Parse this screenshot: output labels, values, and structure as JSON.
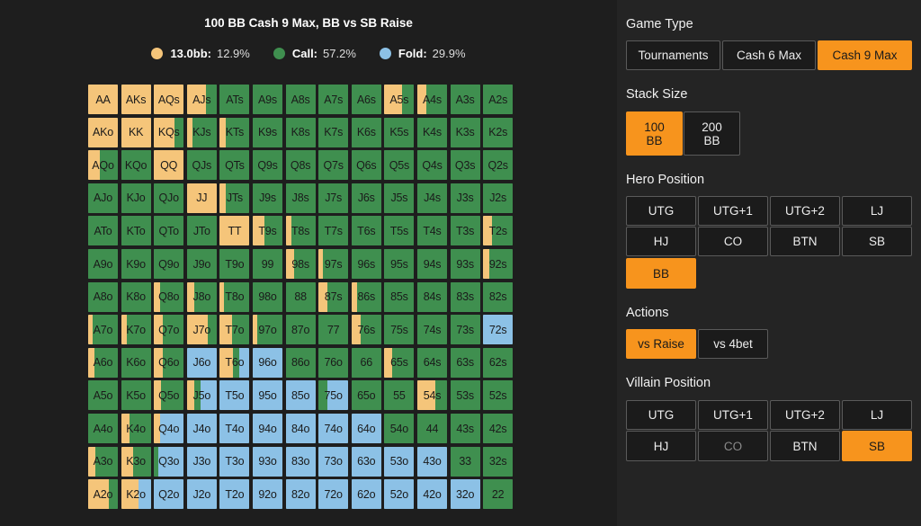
{
  "chart": {
    "title": "100 BB Cash 9 Max, BB vs SB Raise",
    "legend": [
      {
        "label": "13.0bb:",
        "value": "12.9%",
        "color": "#f5c57a"
      },
      {
        "label": "Call:",
        "value": "57.2%",
        "color": "#3f8f4f"
      },
      {
        "label": "Fold:",
        "value": "29.9%",
        "color": "#8cc1e6"
      }
    ]
  },
  "grid": [
    [
      {
        "h": "AA",
        "r": 1,
        "c": 0
      },
      {
        "h": "AKs",
        "r": 1,
        "c": 0
      },
      {
        "h": "AQs",
        "r": 1,
        "c": 0
      },
      {
        "h": "AJs",
        "r": 0.65,
        "c": 0.35
      },
      {
        "h": "ATs",
        "r": 0,
        "c": 1
      },
      {
        "h": "A9s",
        "r": 0,
        "c": 1
      },
      {
        "h": "A8s",
        "r": 0,
        "c": 1
      },
      {
        "h": "A7s",
        "r": 0,
        "c": 1
      },
      {
        "h": "A6s",
        "r": 0,
        "c": 1
      },
      {
        "h": "A5s",
        "r": 0.6,
        "c": 0.4
      },
      {
        "h": "A4s",
        "r": 0.3,
        "c": 0.7
      },
      {
        "h": "A3s",
        "r": 0,
        "c": 1
      },
      {
        "h": "A2s",
        "r": 0,
        "c": 1
      }
    ],
    [
      {
        "h": "AKo",
        "r": 1,
        "c": 0
      },
      {
        "h": "KK",
        "r": 1,
        "c": 0
      },
      {
        "h": "KQs",
        "r": 0.7,
        "c": 0.3
      },
      {
        "h": "KJs",
        "r": 0.2,
        "c": 0.8
      },
      {
        "h": "KTs",
        "r": 0.2,
        "c": 0.8
      },
      {
        "h": "K9s",
        "r": 0,
        "c": 1
      },
      {
        "h": "K8s",
        "r": 0,
        "c": 1
      },
      {
        "h": "K7s",
        "r": 0,
        "c": 1
      },
      {
        "h": "K6s",
        "r": 0,
        "c": 1
      },
      {
        "h": "K5s",
        "r": 0,
        "c": 1
      },
      {
        "h": "K4s",
        "r": 0,
        "c": 1
      },
      {
        "h": "K3s",
        "r": 0,
        "c": 1
      },
      {
        "h": "K2s",
        "r": 0,
        "c": 1
      }
    ],
    [
      {
        "h": "AQo",
        "r": 0.4,
        "c": 0.6
      },
      {
        "h": "KQo",
        "r": 0,
        "c": 1
      },
      {
        "h": "QQ",
        "r": 1,
        "c": 0
      },
      {
        "h": "QJs",
        "r": 0,
        "c": 1
      },
      {
        "h": "QTs",
        "r": 0,
        "c": 1
      },
      {
        "h": "Q9s",
        "r": 0,
        "c": 1
      },
      {
        "h": "Q8s",
        "r": 0,
        "c": 1
      },
      {
        "h": "Q7s",
        "r": 0,
        "c": 1
      },
      {
        "h": "Q6s",
        "r": 0,
        "c": 1
      },
      {
        "h": "Q5s",
        "r": 0,
        "c": 1
      },
      {
        "h": "Q4s",
        "r": 0,
        "c": 1
      },
      {
        "h": "Q3s",
        "r": 0,
        "c": 1
      },
      {
        "h": "Q2s",
        "r": 0,
        "c": 1
      }
    ],
    [
      {
        "h": "AJo",
        "r": 0,
        "c": 1
      },
      {
        "h": "KJo",
        "r": 0,
        "c": 1
      },
      {
        "h": "QJo",
        "r": 0,
        "c": 1
      },
      {
        "h": "JJ",
        "r": 1,
        "c": 0
      },
      {
        "h": "JTs",
        "r": 0.2,
        "c": 0.8
      },
      {
        "h": "J9s",
        "r": 0,
        "c": 1
      },
      {
        "h": "J8s",
        "r": 0,
        "c": 1
      },
      {
        "h": "J7s",
        "r": 0,
        "c": 1
      },
      {
        "h": "J6s",
        "r": 0,
        "c": 1
      },
      {
        "h": "J5s",
        "r": 0,
        "c": 1
      },
      {
        "h": "J4s",
        "r": 0,
        "c": 1
      },
      {
        "h": "J3s",
        "r": 0,
        "c": 1
      },
      {
        "h": "J2s",
        "r": 0,
        "c": 1
      }
    ],
    [
      {
        "h": "ATo",
        "r": 0,
        "c": 1
      },
      {
        "h": "KTo",
        "r": 0,
        "c": 1
      },
      {
        "h": "QTo",
        "r": 0,
        "c": 1
      },
      {
        "h": "JTo",
        "r": 0,
        "c": 1
      },
      {
        "h": "TT",
        "r": 1,
        "c": 0
      },
      {
        "h": "T9s",
        "r": 0.4,
        "c": 0.6
      },
      {
        "h": "T8s",
        "r": 0.2,
        "c": 0.8
      },
      {
        "h": "T7s",
        "r": 0,
        "c": 1
      },
      {
        "h": "T6s",
        "r": 0,
        "c": 1
      },
      {
        "h": "T5s",
        "r": 0,
        "c": 1
      },
      {
        "h": "T4s",
        "r": 0,
        "c": 1
      },
      {
        "h": "T3s",
        "r": 0,
        "c": 1
      },
      {
        "h": "T2s",
        "r": 0.3,
        "c": 0.7
      }
    ],
    [
      {
        "h": "A9o",
        "r": 0,
        "c": 1
      },
      {
        "h": "K9o",
        "r": 0,
        "c": 1
      },
      {
        "h": "Q9o",
        "r": 0,
        "c": 1
      },
      {
        "h": "J9o",
        "r": 0,
        "c": 1
      },
      {
        "h": "T9o",
        "r": 0,
        "c": 1
      },
      {
        "h": "99",
        "r": 0,
        "c": 1
      },
      {
        "h": "98s",
        "r": 0.3,
        "c": 0.7
      },
      {
        "h": "97s",
        "r": 0.15,
        "c": 0.85
      },
      {
        "h": "96s",
        "r": 0,
        "c": 1
      },
      {
        "h": "95s",
        "r": 0,
        "c": 1
      },
      {
        "h": "94s",
        "r": 0,
        "c": 1
      },
      {
        "h": "93s",
        "r": 0,
        "c": 1
      },
      {
        "h": "92s",
        "r": 0.2,
        "c": 0.8
      }
    ],
    [
      {
        "h": "A8o",
        "r": 0,
        "c": 1
      },
      {
        "h": "K8o",
        "r": 0,
        "c": 1
      },
      {
        "h": "Q8o",
        "r": 0.2,
        "c": 0.8
      },
      {
        "h": "J8o",
        "r": 0.25,
        "c": 0.75
      },
      {
        "h": "T8o",
        "r": 0.15,
        "c": 0.85
      },
      {
        "h": "98o",
        "r": 0,
        "c": 1
      },
      {
        "h": "88",
        "r": 0,
        "c": 1
      },
      {
        "h": "87s",
        "r": 0.3,
        "c": 0.7
      },
      {
        "h": "86s",
        "r": 0.2,
        "c": 0.8
      },
      {
        "h": "85s",
        "r": 0,
        "c": 1
      },
      {
        "h": "84s",
        "r": 0,
        "c": 1
      },
      {
        "h": "83s",
        "r": 0,
        "c": 1
      },
      {
        "h": "82s",
        "r": 0,
        "c": 1
      }
    ],
    [
      {
        "h": "A7o",
        "r": 0.15,
        "c": 0.85
      },
      {
        "h": "K7o",
        "r": 0.2,
        "c": 0.8
      },
      {
        "h": "Q7o",
        "r": 0.3,
        "c": 0.7
      },
      {
        "h": "J7o",
        "r": 0.7,
        "c": 0.3
      },
      {
        "h": "T7o",
        "r": 0.4,
        "c": 0.6
      },
      {
        "h": "97o",
        "r": 0.15,
        "c": 0.85
      },
      {
        "h": "87o",
        "r": 0,
        "c": 1
      },
      {
        "h": "77",
        "r": 0,
        "c": 1
      },
      {
        "h": "76s",
        "r": 0.3,
        "c": 0.7
      },
      {
        "h": "75s",
        "r": 0,
        "c": 1
      },
      {
        "h": "74s",
        "r": 0,
        "c": 1
      },
      {
        "h": "73s",
        "r": 0,
        "c": 1
      },
      {
        "h": "72s",
        "r": 0,
        "c": 0
      }
    ],
    [
      {
        "h": "A6o",
        "r": 0.2,
        "c": 0.8
      },
      {
        "h": "K6o",
        "r": 0,
        "c": 1
      },
      {
        "h": "Q6o",
        "r": 0.3,
        "c": 0.7
      },
      {
        "h": "J6o",
        "r": 0,
        "c": 0
      },
      {
        "h": "T6o",
        "r": 0.45,
        "c": 0.2
      },
      {
        "h": "96o",
        "r": 0,
        "c": 0
      },
      {
        "h": "86o",
        "r": 0,
        "c": 1
      },
      {
        "h": "76o",
        "r": 0,
        "c": 1
      },
      {
        "h": "66",
        "r": 0,
        "c": 1
      },
      {
        "h": "65s",
        "r": 0.25,
        "c": 0.75
      },
      {
        "h": "64s",
        "r": 0,
        "c": 1
      },
      {
        "h": "63s",
        "r": 0,
        "c": 1
      },
      {
        "h": "62s",
        "r": 0,
        "c": 1
      }
    ],
    [
      {
        "h": "A5o",
        "r": 0,
        "c": 1
      },
      {
        "h": "K5o",
        "r": 0,
        "c": 1
      },
      {
        "h": "Q5o",
        "r": 0.25,
        "c": 0.75
      },
      {
        "h": "J5o",
        "r": 0.25,
        "c": 0.2
      },
      {
        "h": "T5o",
        "r": 0,
        "c": 0
      },
      {
        "h": "95o",
        "r": 0,
        "c": 0
      },
      {
        "h": "85o",
        "r": 0,
        "c": 0
      },
      {
        "h": "75o",
        "r": 0,
        "c": 0.3
      },
      {
        "h": "65o",
        "r": 0,
        "c": 1
      },
      {
        "h": "55",
        "r": 0,
        "c": 1
      },
      {
        "h": "54s",
        "r": 0.6,
        "c": 0.4
      },
      {
        "h": "53s",
        "r": 0,
        "c": 1
      },
      {
        "h": "52s",
        "r": 0,
        "c": 1
      }
    ],
    [
      {
        "h": "A4o",
        "r": 0,
        "c": 1
      },
      {
        "h": "K4o",
        "r": 0.3,
        "c": 0.7
      },
      {
        "h": "Q4o",
        "r": 0.2,
        "c": 0
      },
      {
        "h": "J4o",
        "r": 0,
        "c": 0
      },
      {
        "h": "T4o",
        "r": 0,
        "c": 0
      },
      {
        "h": "94o",
        "r": 0,
        "c": 0
      },
      {
        "h": "84o",
        "r": 0,
        "c": 0
      },
      {
        "h": "74o",
        "r": 0,
        "c": 0
      },
      {
        "h": "64o",
        "r": 0,
        "c": 0
      },
      {
        "h": "54o",
        "r": 0,
        "c": 1
      },
      {
        "h": "44",
        "r": 0,
        "c": 1
      },
      {
        "h": "43s",
        "r": 0,
        "c": 1
      },
      {
        "h": "42s",
        "r": 0,
        "c": 1
      }
    ],
    [
      {
        "h": "A3o",
        "r": 0.25,
        "c": 0.75
      },
      {
        "h": "K3o",
        "r": 0.4,
        "c": 0.6
      },
      {
        "h": "Q3o",
        "r": 0,
        "c": 0.15
      },
      {
        "h": "J3o",
        "r": 0,
        "c": 0
      },
      {
        "h": "T3o",
        "r": 0,
        "c": 0
      },
      {
        "h": "93o",
        "r": 0,
        "c": 0
      },
      {
        "h": "83o",
        "r": 0,
        "c": 0
      },
      {
        "h": "73o",
        "r": 0,
        "c": 0
      },
      {
        "h": "63o",
        "r": 0,
        "c": 0
      },
      {
        "h": "53o",
        "r": 0,
        "c": 0
      },
      {
        "h": "43o",
        "r": 0,
        "c": 0
      },
      {
        "h": "33",
        "r": 0,
        "c": 1
      },
      {
        "h": "32s",
        "r": 0,
        "c": 1
      }
    ],
    [
      {
        "h": "A2o",
        "r": 0.7,
        "c": 0.3
      },
      {
        "h": "K2o",
        "r": 0.6,
        "c": 0
      },
      {
        "h": "Q2o",
        "r": 0,
        "c": 0
      },
      {
        "h": "J2o",
        "r": 0,
        "c": 0
      },
      {
        "h": "T2o",
        "r": 0,
        "c": 0
      },
      {
        "h": "92o",
        "r": 0,
        "c": 0
      },
      {
        "h": "82o",
        "r": 0,
        "c": 0
      },
      {
        "h": "72o",
        "r": 0,
        "c": 0
      },
      {
        "h": "62o",
        "r": 0,
        "c": 0
      },
      {
        "h": "52o",
        "r": 0,
        "c": 0
      },
      {
        "h": "42o",
        "r": 0,
        "c": 0
      },
      {
        "h": "32o",
        "r": 0,
        "c": 0
      },
      {
        "h": "22",
        "r": 0,
        "c": 1
      }
    ]
  ],
  "colors": {
    "raise": "#f5c57a",
    "call": "#3f8f4f",
    "fold": "#8cc1e6",
    "accent": "#f7941d"
  },
  "sidebar": {
    "game_type": {
      "label": "Game Type",
      "options": [
        "Tournaments",
        "Cash 6 Max",
        "Cash 9 Max"
      ],
      "selected": "Cash 9 Max"
    },
    "stack_size": {
      "label": "Stack Size",
      "options": [
        "100 BB",
        "200 BB"
      ],
      "selected": "100 BB"
    },
    "hero_position": {
      "label": "Hero Position",
      "options": [
        "UTG",
        "UTG+1",
        "UTG+2",
        "LJ",
        "HJ",
        "CO",
        "BTN",
        "SB",
        "BB"
      ],
      "selected": "BB"
    },
    "actions": {
      "label": "Actions",
      "options": [
        "vs Raise",
        "vs 4bet"
      ],
      "selected": "vs Raise"
    },
    "villain_position": {
      "label": "Villain Position",
      "options": [
        "UTG",
        "UTG+1",
        "UTG+2",
        "LJ",
        "HJ",
        "CO",
        "BTN",
        "SB"
      ],
      "selected": "SB",
      "disabled": [
        "CO"
      ]
    }
  }
}
